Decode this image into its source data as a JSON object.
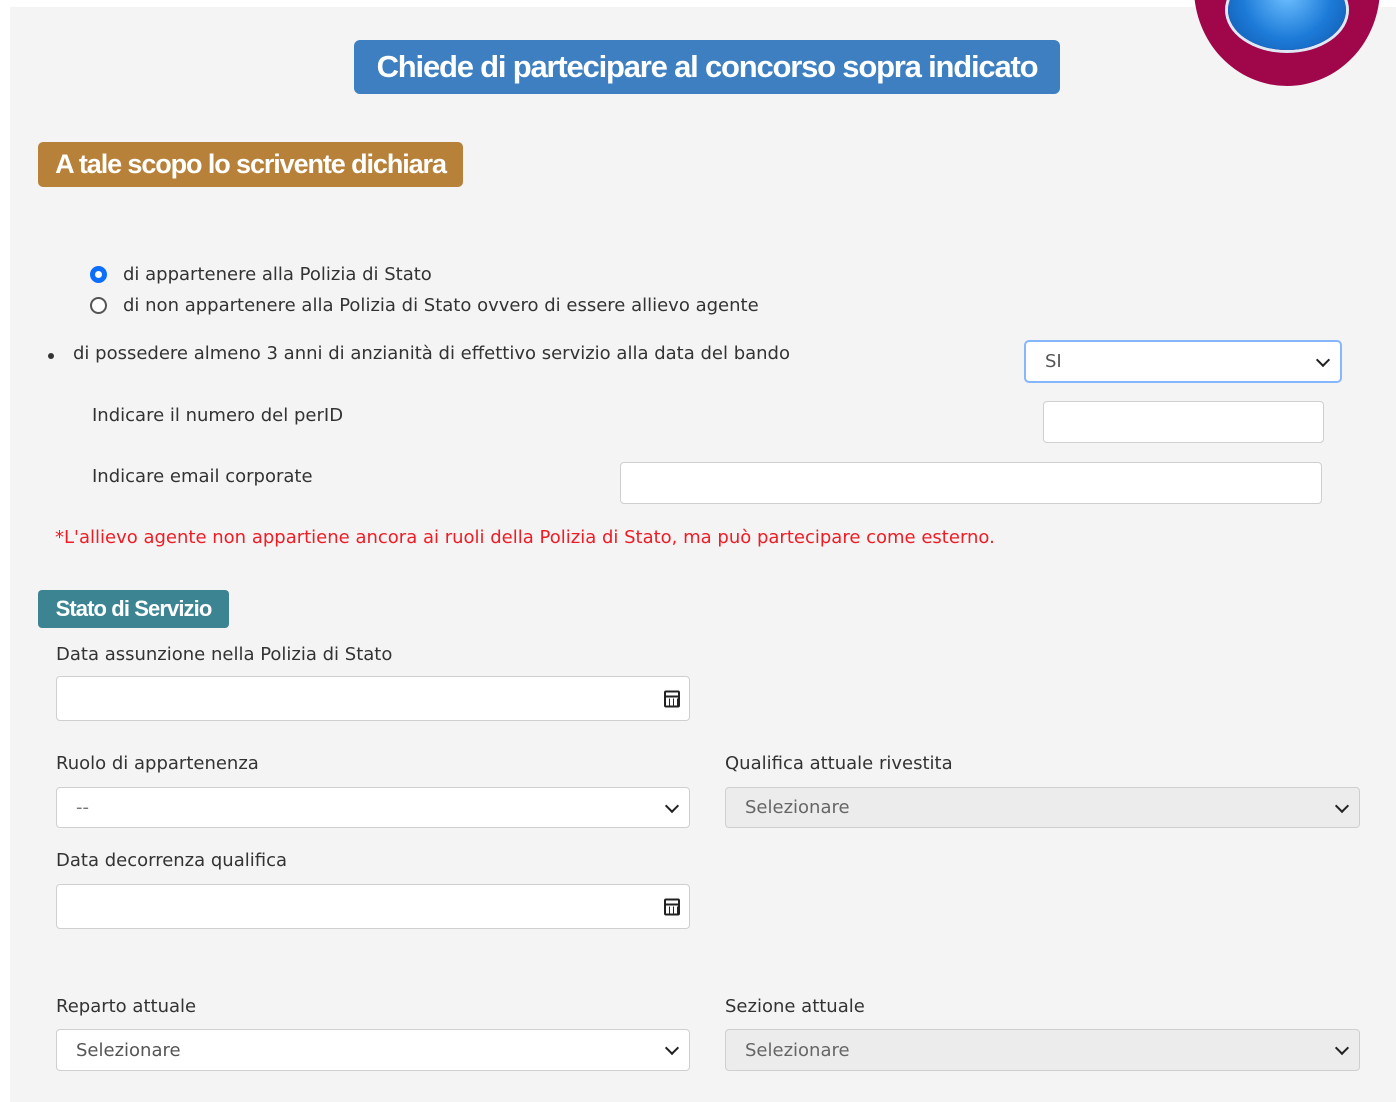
{
  "header": {
    "title": "Chiede di partecipare al concorso sopra indicato",
    "declaration_title": "A tale scopo lo scrivente dichiara"
  },
  "membership": {
    "options": [
      {
        "label": "di appartenere alla Polizia di Stato",
        "checked": true
      },
      {
        "label": "di non appartenere alla Polizia di Stato ovvero di essere allievo agente",
        "checked": false
      }
    ],
    "seniority_label": "di possedere almeno 3 anni di anzianità di effettivo servizio alla data del bando",
    "seniority_value": "SI",
    "perid_label": "Indicare il numero del perID",
    "perid_value": "",
    "email_label": "Indicare email corporate",
    "email_value": "",
    "note": "*L'allievo agente non appartiene ancora ai ruoli della Polizia di Stato, ma può partecipare come esterno."
  },
  "service": {
    "title": "Stato di Servizio",
    "hire_date_label": "Data assunzione nella Polizia di Stato",
    "hire_date_value": "",
    "role_label": "Ruolo di appartenenza",
    "role_value": "--",
    "qualification_label": "Qualifica attuale rivestita",
    "qualification_value": "Selezionare",
    "qualification_date_label": "Data decorrenza qualifica",
    "qualification_date_value": "",
    "department_label": "Reparto attuale",
    "department_value": "Selezionare",
    "section_label": "Sezione attuale",
    "section_value": "Selezionare"
  },
  "colors": {
    "title_badge": "#3d7fc1",
    "declaration_badge": "#b78139",
    "service_badge": "#3d8493",
    "home_ring": "#a0064a",
    "note": "#ef1c25",
    "radio_checked": "#0d6efd"
  },
  "icons": [
    "home-icon",
    "calendar-icon",
    "chevron-down-icon"
  ]
}
